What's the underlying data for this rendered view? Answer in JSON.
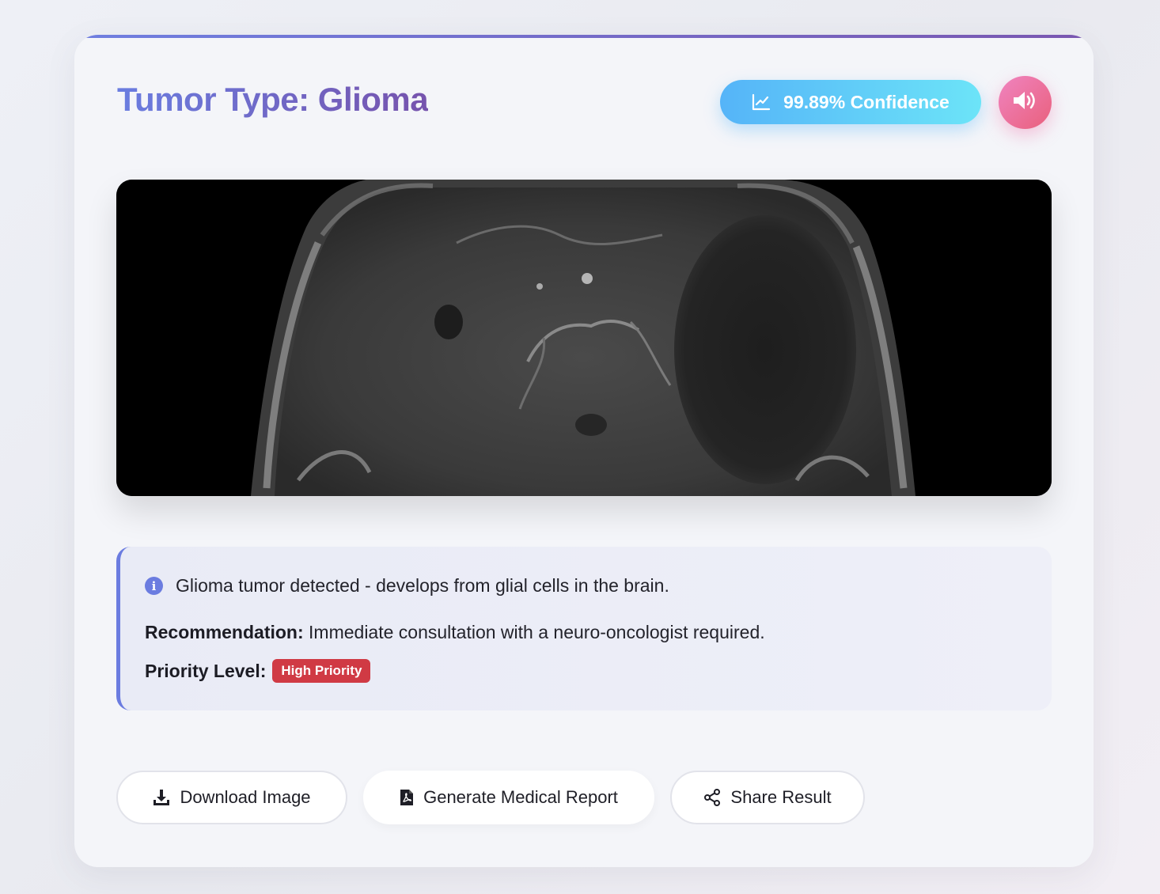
{
  "result": {
    "title": "Tumor Type: Glioma",
    "confidence_label": "99.89% Confidence",
    "confidence_icon": "chart-line-icon",
    "speaker_icon": "volume-icon"
  },
  "scan": {
    "icon": "mri-scan-image"
  },
  "info": {
    "icon": "info-circle-icon",
    "description": "Glioma tumor detected - develops from glial cells in the brain.",
    "recommendation_label": "Recommendation:",
    "recommendation_text": " Immediate consultation with a neuro-oncologist required.",
    "priority_label": "Priority Level:",
    "priority_badge": "High Priority"
  },
  "actions": {
    "download_label": "Download Image",
    "report_label": "Generate Medical Report",
    "share_label": "Share Result"
  },
  "colors": {
    "accent": "#6b7ce0",
    "title_gradient_end": "#7653ad",
    "confidence_start": "#55b4f8",
    "confidence_end": "#6ce4f8",
    "speaker_start": "#f084c0",
    "speaker_end": "#e9607c",
    "priority_high": "#d03a44"
  }
}
